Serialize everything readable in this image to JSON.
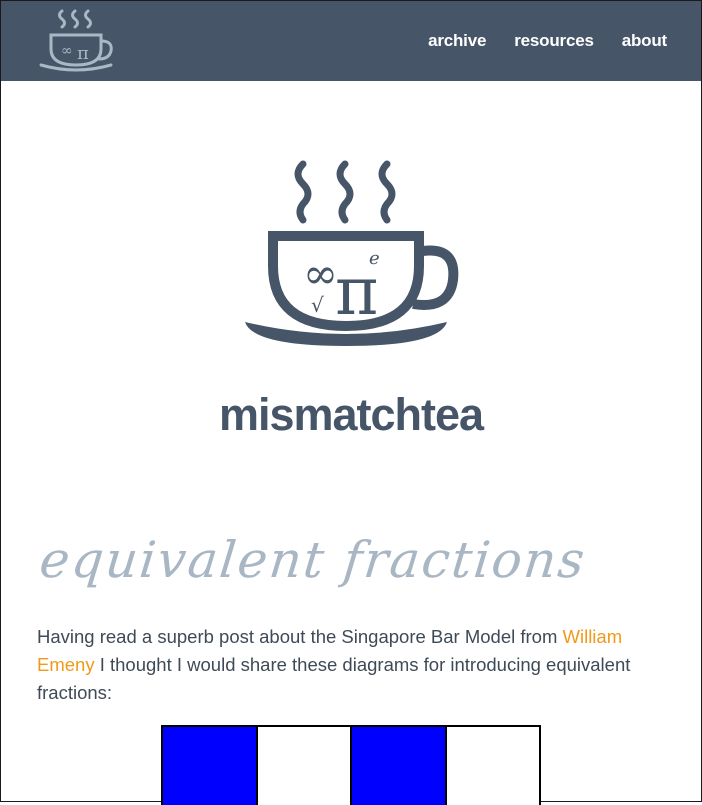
{
  "nav": {
    "items": [
      {
        "label": "archive"
      },
      {
        "label": "resources"
      },
      {
        "label": "about"
      }
    ]
  },
  "site": {
    "name": "mismatchtea",
    "logo_icon": "teacup-logo-icon"
  },
  "post": {
    "title": "equivalent fractions",
    "intro_before_link": "Having read a superb post about the Singapore Bar Model from ",
    "link_text": "William Emeny",
    "intro_after_link": " I thought I would share these diagrams for introducing equivalent fractions:"
  },
  "diagram": {
    "parts": 4,
    "shaded": [
      true,
      false,
      true,
      false
    ],
    "shaded_color": "#0000ff",
    "empty_color": "#ffffff"
  },
  "colors": {
    "header_bg": "#465567",
    "brand": "#465567",
    "title": "#a9b6c4",
    "link": "#f19a1a",
    "logo_light": "#aab8c6"
  }
}
